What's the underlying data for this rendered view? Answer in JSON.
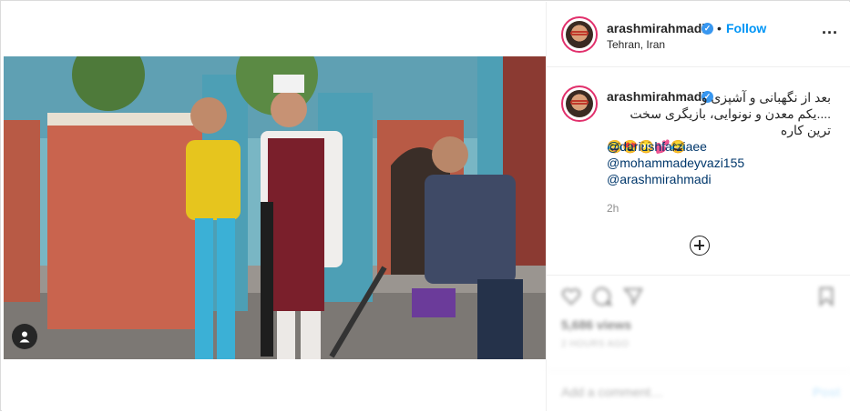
{
  "header": {
    "username": "arashmirahmadi",
    "verified_mark": "✓",
    "separator": "•",
    "follow_label": "Follow",
    "location": "Tehran, Iran",
    "more_label": "..."
  },
  "caption": {
    "username": "arashmirahmadi",
    "verified_mark": "✓",
    "line1": "بعد از نگهبانی و آشپزی و",
    "line2": "....یکم معدن و نونوایی، بازیگری سخت ترین کاره",
    "emoji": "😂😍😳💕😂",
    "mentions": [
      "@dariushfarziaee",
      "@mohammadeyvazi155",
      "@arashmirahmadi"
    ],
    "timestamp": "2h"
  },
  "lower": {
    "likes": "5,686 views",
    "date": "2 HOURS AGO",
    "comment_placeholder": "Add a comment…",
    "post_label": "Post"
  },
  "icons": {
    "user_tag": "user-tag-icon",
    "more": "more-options-icon",
    "load_more": "plus-circle-icon",
    "like": "heart-icon",
    "comment": "comment-icon",
    "share": "share-icon",
    "save": "bookmark-icon"
  },
  "colors": {
    "accent": "#0095f6",
    "verified": "#3897f0",
    "mention": "#00376b",
    "border": "#dbdbdb"
  }
}
